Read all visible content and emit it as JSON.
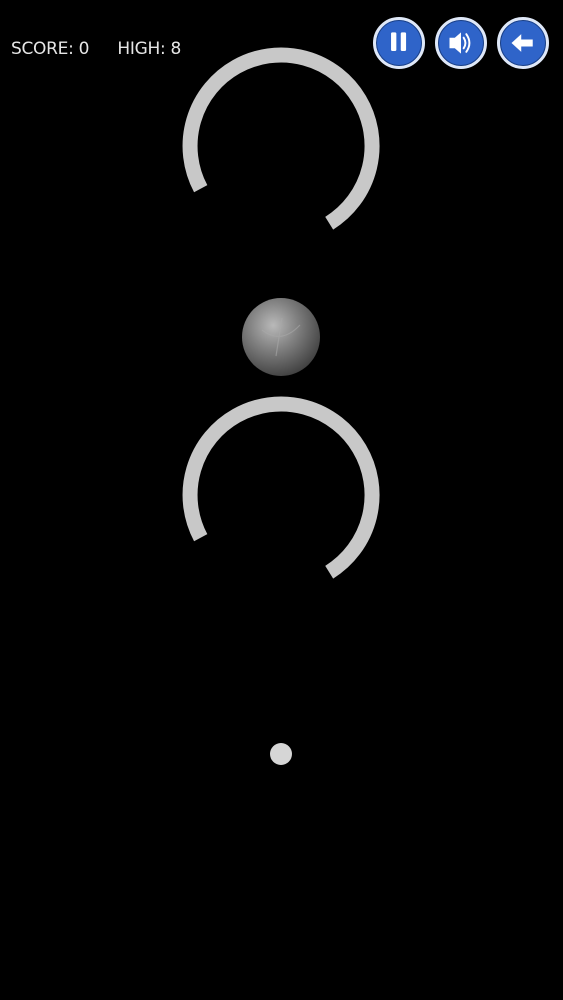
{
  "hud": {
    "score_label": "SCORE:",
    "score_value": "0",
    "high_label": "HIGH:",
    "high_value": "8"
  },
  "controls": {
    "pause_icon": "pause-icon",
    "sound_icon": "speaker-icon",
    "back_icon": "back-arrow-icon"
  },
  "colors": {
    "background": "#000000",
    "ring": "#c8c8c8",
    "ball": "#7a7a7a",
    "button_fill": "#2f64c9",
    "button_border": "#dfe8f8",
    "hud_text": "#e6e6e6"
  }
}
